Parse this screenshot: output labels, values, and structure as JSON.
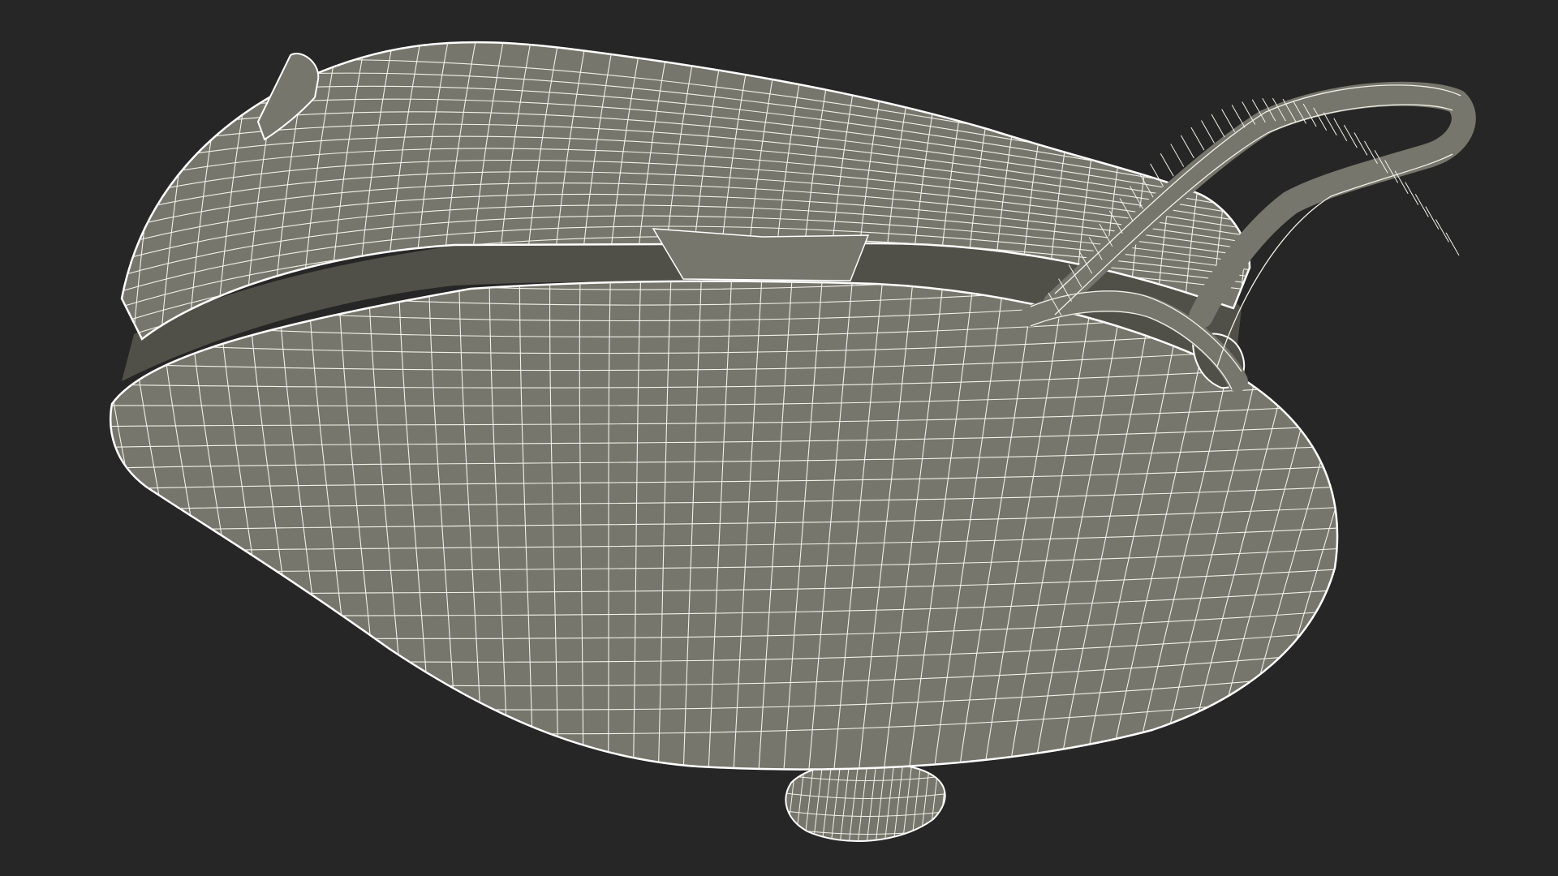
{
  "scene": {
    "background_color": "#262626",
    "surface_color": "#76766c",
    "surface_shadow_color": "#505048",
    "wire_color": "#f2f2ea",
    "edge_wire_color": "#ffffff"
  }
}
